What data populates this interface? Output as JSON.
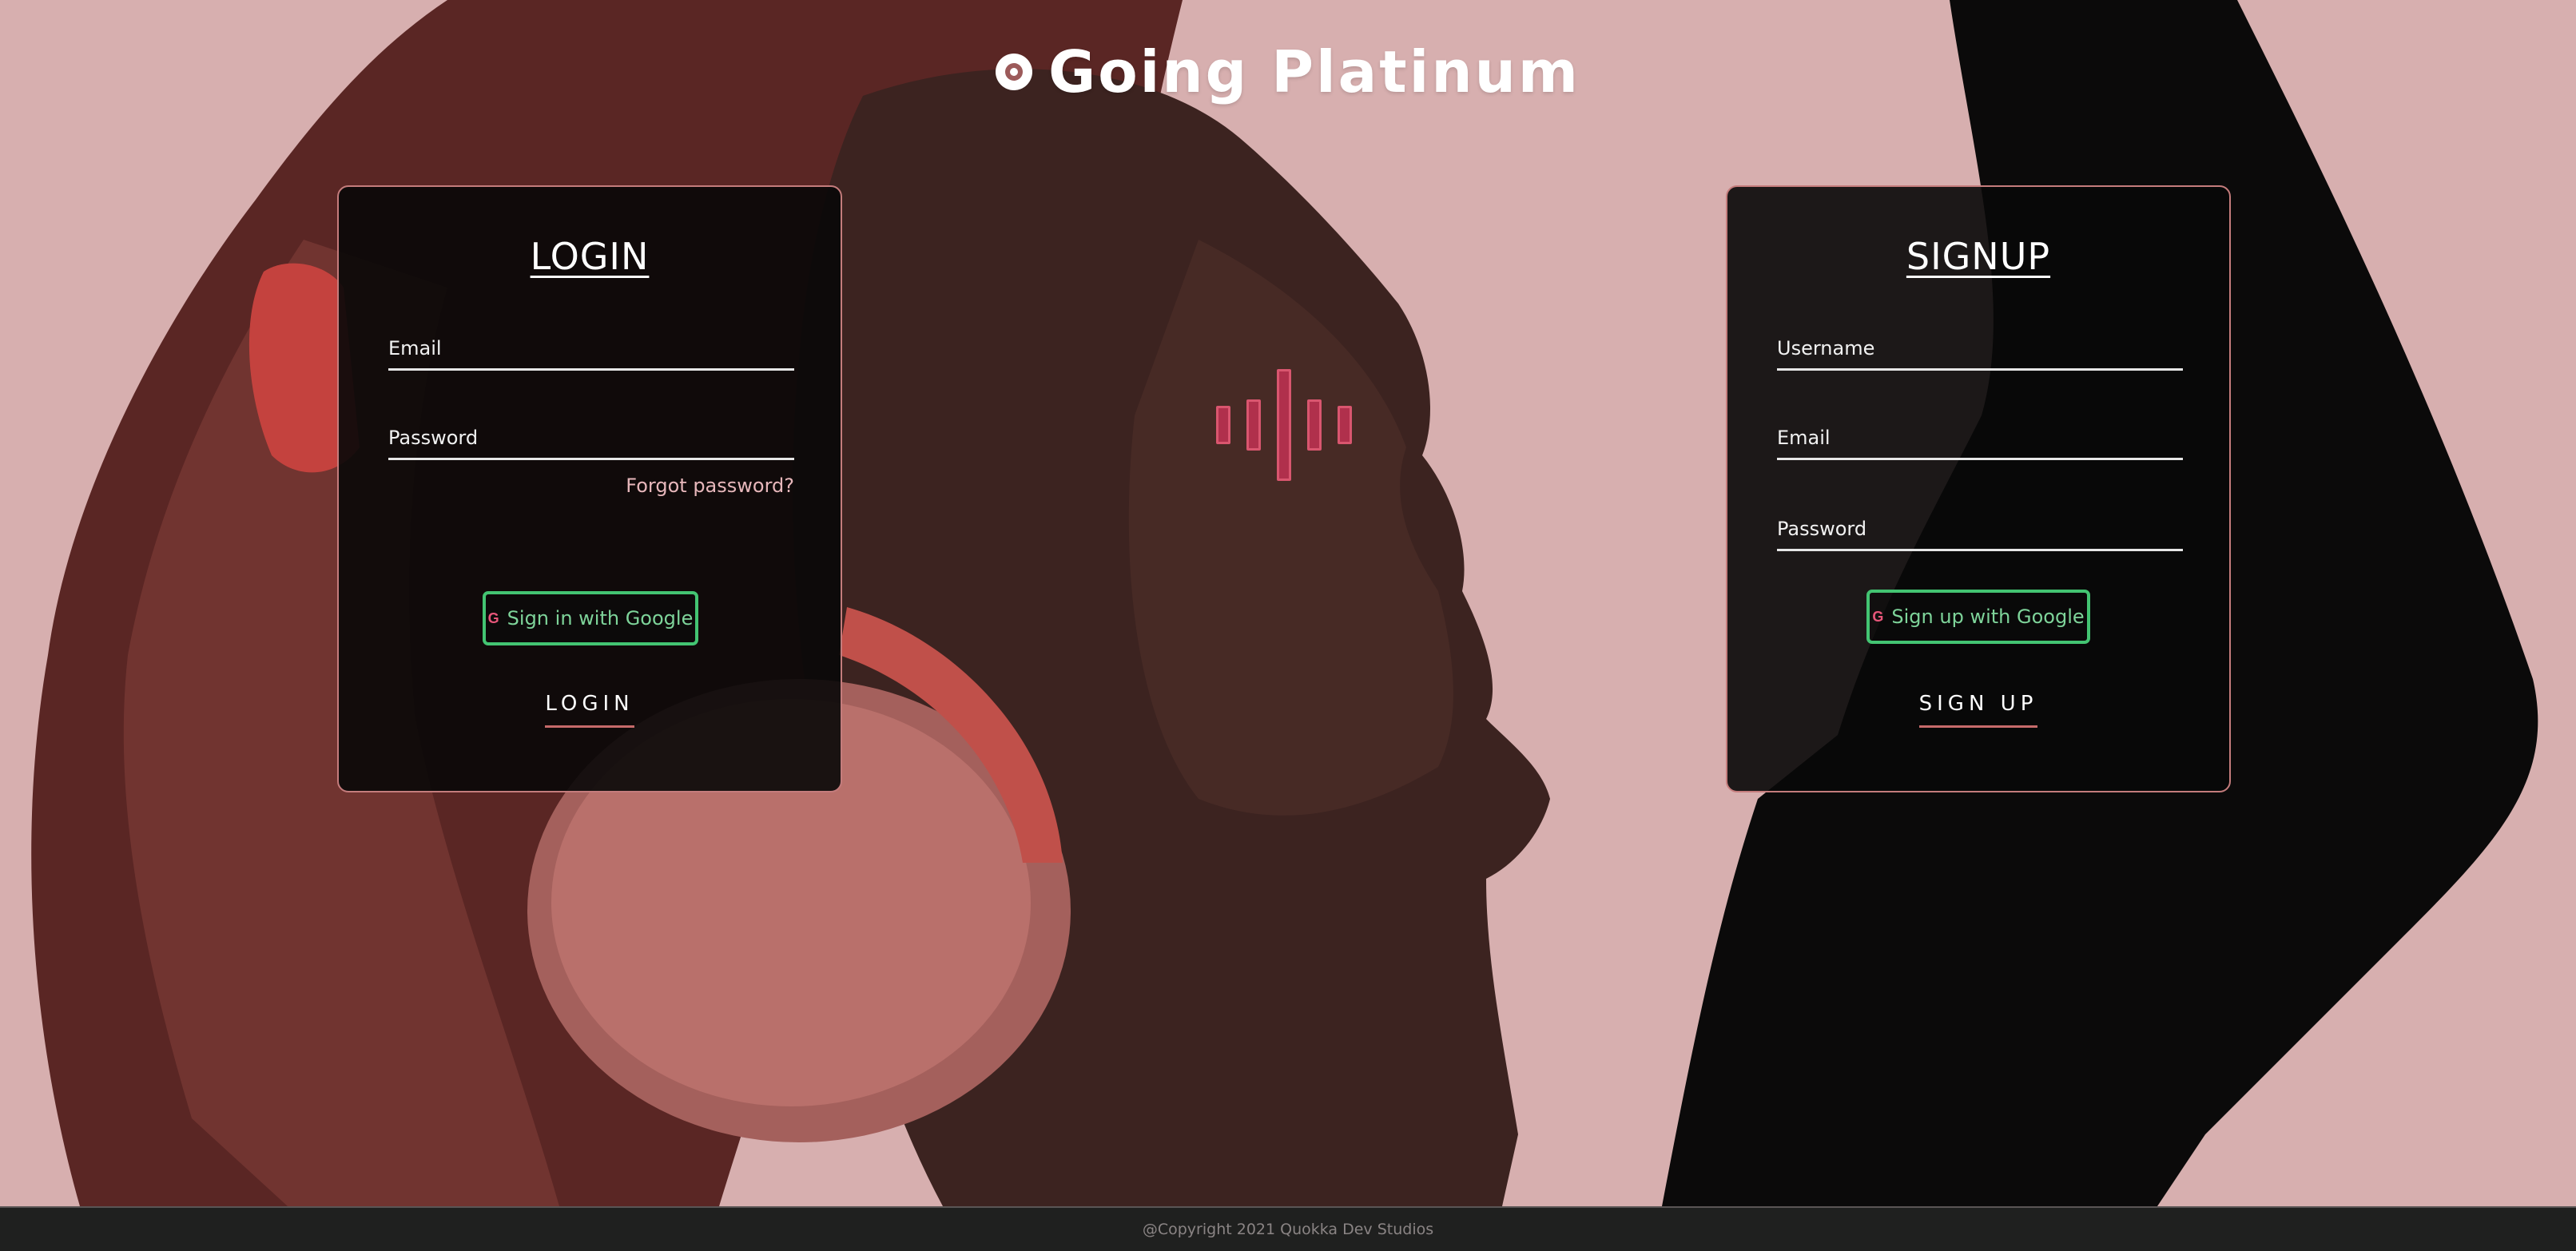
{
  "brand": {
    "icon": "vinyl-record-icon",
    "title": "Going Platinum"
  },
  "sound_bars_icon": "sound-wave-icon",
  "login": {
    "title": "LOGIN",
    "email_placeholder": "Email",
    "password_placeholder": "Password",
    "forgot_password": "Forgot password?",
    "google_icon": "G",
    "google_button": "Sign in with Google",
    "submit": "LOGIN"
  },
  "signup": {
    "title": "SIGNUP",
    "username_placeholder": "Username",
    "email_placeholder": "Email",
    "password_placeholder": "Password",
    "google_icon": "G",
    "google_button": "Sign up with Google",
    "submit": "SIGN UP"
  },
  "footer": {
    "copyright": "@Copyright 2021 Quokka Dev Studios"
  },
  "colors": {
    "background": "#d7afaf",
    "card": "#0a0a0a",
    "card_border": "#c47c7c",
    "google_border": "#43c472",
    "accent_pink": "#e7b7bb",
    "footer": "#1f201f"
  }
}
